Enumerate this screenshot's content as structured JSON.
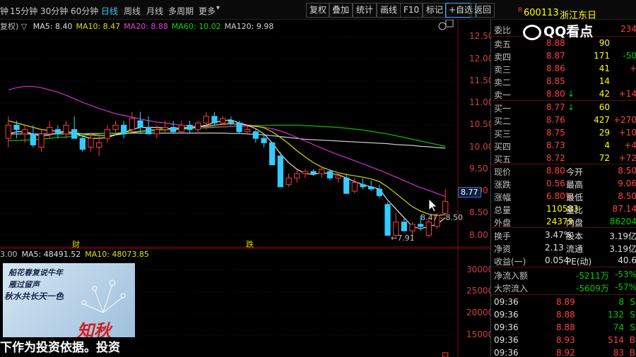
{
  "toolbar": {
    "periods": [
      "钟",
      "15分钟",
      "30分钟",
      "60分钟",
      "日线",
      "周线",
      "月线",
      "多周期",
      "更多"
    ],
    "active_period": "日线",
    "buttons": [
      "复权",
      "叠加",
      "统计",
      "画线",
      "F10",
      "标记",
      "+自选",
      "返回"
    ]
  },
  "stock": {
    "code": "600113",
    "name": "浙江东日",
    "code_prefix": "R"
  },
  "ma_legend": {
    "prefix": "复权) ▽",
    "items": [
      {
        "label": "MA5: 8.40",
        "color": "#e0e0e0"
      },
      {
        "label": "MA10: 8.47",
        "color": "#e0e000"
      },
      {
        "label": "MA20: 8.88",
        "color": "#e040e0"
      },
      {
        "label": "MA60: 10.02",
        "color": "#00dd00"
      },
      {
        "label": "MA120: 9.98",
        "color": "#d0d0d0"
      }
    ]
  },
  "vol_legend": {
    "items": [
      {
        "label": "3.00",
        "color": "#c0c0c0"
      },
      {
        "label": "MA5: 48491.52",
        "color": "#e0e0e0"
      },
      {
        "label": "MA10: 48073.85",
        "color": "#e0e000"
      }
    ]
  },
  "price_axis": [
    "12.50",
    "12.00",
    "11.50",
    "11.00",
    "10.50",
    "10.00",
    "9.50",
    "9.00",
    "8.50",
    "8.00"
  ],
  "vol_axis": [
    "30000",
    "25000",
    "20000",
    "15000"
  ],
  "annotations": {
    "current_price": "8.77",
    "ma_flag": "8.47 - 8.50",
    "low_flag": "←7.91",
    "event_1": "财",
    "event_2": "跌"
  },
  "chart_data": {
    "type": "candlestick",
    "ylim": [
      7.8,
      12.7
    ],
    "candles": [
      {
        "o": 10.2,
        "h": 10.7,
        "l": 10.0,
        "c": 10.5
      },
      {
        "o": 10.5,
        "h": 10.6,
        "l": 10.2,
        "c": 10.4
      },
      {
        "o": 10.3,
        "h": 10.5,
        "l": 10.1,
        "c": 10.4
      },
      {
        "o": 10.3,
        "h": 10.5,
        "l": 10.0,
        "c": 10.05
      },
      {
        "o": 10.0,
        "h": 10.4,
        "l": 9.9,
        "c": 10.3
      },
      {
        "o": 10.3,
        "h": 10.6,
        "l": 10.2,
        "c": 10.45
      },
      {
        "o": 10.4,
        "h": 10.5,
        "l": 10.2,
        "c": 10.3
      },
      {
        "o": 10.3,
        "h": 10.6,
        "l": 10.2,
        "c": 10.5
      },
      {
        "o": 10.4,
        "h": 10.7,
        "l": 10.2,
        "c": 10.2
      },
      {
        "o": 10.2,
        "h": 10.3,
        "l": 9.9,
        "c": 9.95
      },
      {
        "o": 10.0,
        "h": 10.3,
        "l": 9.9,
        "c": 10.2
      },
      {
        "o": 10.0,
        "h": 10.3,
        "l": 9.8,
        "c": 10.1
      },
      {
        "o": 10.2,
        "h": 10.5,
        "l": 10.1,
        "c": 10.4
      },
      {
        "o": 10.4,
        "h": 10.6,
        "l": 10.3,
        "c": 10.5
      },
      {
        "o": 10.5,
        "h": 10.6,
        "l": 10.2,
        "c": 10.3
      },
      {
        "o": 10.4,
        "h": 10.8,
        "l": 10.3,
        "c": 10.65
      },
      {
        "o": 10.6,
        "h": 10.8,
        "l": 10.3,
        "c": 10.45
      },
      {
        "o": 10.45,
        "h": 10.7,
        "l": 10.3,
        "c": 10.3
      },
      {
        "o": 10.3,
        "h": 10.5,
        "l": 10.2,
        "c": 10.4
      },
      {
        "o": 10.4,
        "h": 10.6,
        "l": 10.3,
        "c": 10.45
      },
      {
        "o": 10.45,
        "h": 10.6,
        "l": 10.3,
        "c": 10.35
      },
      {
        "o": 10.35,
        "h": 10.6,
        "l": 10.3,
        "c": 10.5
      },
      {
        "o": 10.5,
        "h": 10.6,
        "l": 10.3,
        "c": 10.4
      },
      {
        "o": 10.4,
        "h": 10.6,
        "l": 10.3,
        "c": 10.55
      },
      {
        "o": 10.55,
        "h": 10.8,
        "l": 10.4,
        "c": 10.7
      },
      {
        "o": 10.7,
        "h": 10.8,
        "l": 10.5,
        "c": 10.55
      },
      {
        "o": 10.55,
        "h": 10.7,
        "l": 10.5,
        "c": 10.65
      },
      {
        "o": 10.6,
        "h": 10.7,
        "l": 10.5,
        "c": 10.55
      },
      {
        "o": 10.55,
        "h": 10.6,
        "l": 10.3,
        "c": 10.35
      },
      {
        "o": 10.35,
        "h": 10.5,
        "l": 10.3,
        "c": 10.4
      },
      {
        "o": 10.35,
        "h": 10.4,
        "l": 10.1,
        "c": 10.2
      },
      {
        "o": 10.2,
        "h": 10.3,
        "l": 10.0,
        "c": 10.1
      },
      {
        "o": 10.1,
        "h": 10.1,
        "l": 9.6,
        "c": 9.6
      },
      {
        "o": 9.8,
        "h": 9.9,
        "l": 9.1,
        "c": 9.1
      },
      {
        "o": 9.15,
        "h": 9.4,
        "l": 9.1,
        "c": 9.3
      },
      {
        "o": 9.3,
        "h": 9.5,
        "l": 9.2,
        "c": 9.4
      },
      {
        "o": 9.4,
        "h": 9.5,
        "l": 9.3,
        "c": 9.45
      },
      {
        "o": 9.45,
        "h": 9.5,
        "l": 9.35,
        "c": 9.4
      },
      {
        "o": 9.4,
        "h": 9.55,
        "l": 9.3,
        "c": 9.5
      },
      {
        "o": 9.45,
        "h": 9.5,
        "l": 9.25,
        "c": 9.3
      },
      {
        "o": 9.3,
        "h": 9.4,
        "l": 9.2,
        "c": 9.35
      },
      {
        "o": 9.3,
        "h": 9.4,
        "l": 8.95,
        "c": 8.95
      },
      {
        "o": 9.0,
        "h": 9.3,
        "l": 8.95,
        "c": 9.2
      },
      {
        "o": 9.15,
        "h": 9.3,
        "l": 9.05,
        "c": 9.1
      },
      {
        "o": 9.1,
        "h": 9.25,
        "l": 9.0,
        "c": 9.05
      },
      {
        "o": 9.05,
        "h": 9.15,
        "l": 8.85,
        "c": 8.9
      },
      {
        "o": 8.7,
        "h": 8.75,
        "l": 8.0,
        "c": 8.0
      },
      {
        "o": 8.0,
        "h": 8.5,
        "l": 7.95,
        "c": 8.3
      },
      {
        "o": 8.3,
        "h": 8.4,
        "l": 8.1,
        "c": 8.1
      },
      {
        "o": 8.1,
        "h": 8.3,
        "l": 7.91,
        "c": 8.25
      },
      {
        "o": 8.25,
        "h": 8.45,
        "l": 8.1,
        "c": 8.2
      },
      {
        "o": 8.0,
        "h": 8.4,
        "l": 7.95,
        "c": 8.3
      },
      {
        "o": 8.2,
        "h": 8.5,
        "l": 8.15,
        "c": 8.45
      },
      {
        "o": 8.5,
        "h": 9.05,
        "l": 8.45,
        "c": 8.77
      }
    ],
    "ma5": [
      10.3,
      10.35,
      10.35,
      10.3,
      10.25,
      10.28,
      10.32,
      10.35,
      10.32,
      10.25,
      10.2,
      10.2,
      10.22,
      10.28,
      10.33,
      10.4,
      10.45,
      10.45,
      10.45,
      10.44,
      10.4,
      10.42,
      10.44,
      10.46,
      10.5,
      10.56,
      10.6,
      10.62,
      10.55,
      10.5,
      10.42,
      10.3,
      10.1,
      9.85,
      9.65,
      9.5,
      9.4,
      9.38,
      9.42,
      9.4,
      9.38,
      9.3,
      9.22,
      9.15,
      9.1,
      9.05,
      8.8,
      8.6,
      8.4,
      8.2,
      8.15,
      8.2,
      8.25,
      8.4
    ],
    "ma10": [
      10.6,
      10.55,
      10.5,
      10.45,
      10.4,
      10.38,
      10.36,
      10.35,
      10.33,
      10.3,
      10.28,
      10.26,
      10.26,
      10.28,
      10.3,
      10.33,
      10.36,
      10.38,
      10.4,
      10.42,
      10.43,
      10.44,
      10.45,
      10.46,
      10.48,
      10.5,
      10.52,
      10.53,
      10.52,
      10.5,
      10.48,
      10.44,
      10.35,
      10.22,
      10.08,
      9.92,
      9.78,
      9.65,
      9.55,
      9.48,
      9.42,
      9.38,
      9.35,
      9.32,
      9.28,
      9.22,
      9.1,
      8.95,
      8.8,
      8.65,
      8.55,
      8.48,
      8.45,
      8.47
    ],
    "ma20": [
      11.3,
      11.35,
      11.38,
      11.38,
      11.35,
      11.3,
      11.25,
      11.18,
      11.1,
      11.02,
      10.95,
      10.88,
      10.82,
      10.76,
      10.72,
      10.68,
      10.64,
      10.6,
      10.57,
      10.55,
      10.52,
      10.5,
      10.48,
      10.47,
      10.46,
      10.46,
      10.46,
      10.47,
      10.48,
      10.48,
      10.47,
      10.45,
      10.42,
      10.37,
      10.3,
      10.22,
      10.14,
      10.06,
      9.98,
      9.9,
      9.83,
      9.76,
      9.69,
      9.62,
      9.55,
      9.48,
      9.4,
      9.32,
      9.24,
      9.16,
      9.08,
      9.02,
      8.95,
      8.88
    ],
    "ma60": [
      10.15,
      10.15,
      10.16,
      10.17,
      10.18,
      10.2,
      10.22,
      10.23,
      10.25,
      10.26,
      10.28,
      10.3,
      10.31,
      10.32,
      10.34,
      10.35,
      10.36,
      10.37,
      10.38,
      10.39,
      10.4,
      10.41,
      10.42,
      10.43,
      10.44,
      10.45,
      10.46,
      10.47,
      10.48,
      10.48,
      10.49,
      10.49,
      10.5,
      10.5,
      10.5,
      10.5,
      10.49,
      10.48,
      10.47,
      10.46,
      10.45,
      10.43,
      10.41,
      10.39,
      10.36,
      10.33,
      10.3,
      10.26,
      10.22,
      10.18,
      10.14,
      10.1,
      10.06,
      10.02
    ],
    "ma120": [
      10.3,
      10.3,
      10.3,
      10.3,
      10.3,
      10.3,
      10.3,
      10.3,
      10.3,
      10.3,
      10.31,
      10.31,
      10.31,
      10.31,
      10.31,
      10.32,
      10.32,
      10.32,
      10.32,
      10.32,
      10.32,
      10.32,
      10.32,
      10.32,
      10.32,
      10.32,
      10.32,
      10.31,
      10.31,
      10.3,
      10.29,
      10.28,
      10.26,
      10.24,
      10.22,
      10.2,
      10.18,
      10.17,
      10.16,
      10.15,
      10.14,
      10.13,
      10.12,
      10.11,
      10.1,
      10.09,
      10.08,
      10.06,
      10.05,
      10.04,
      10.02,
      10.01,
      9.99,
      9.98
    ],
    "volume_ylim": [
      10000,
      33000
    ],
    "volume_last": 11000
  },
  "order_book": {
    "header": {
      "label": "委比",
      "val1": "",
      "val2": "234"
    },
    "asks": [
      {
        "label": "卖五",
        "price": "8.88",
        "vol": "90",
        "chg": ""
      },
      {
        "label": "卖四",
        "price": "8.87",
        "vol": "171",
        "chg": "-50"
      },
      {
        "label": "卖三",
        "price": "8.86",
        "vol": "41",
        "chg": "+"
      },
      {
        "label": "卖二",
        "price": "8.85",
        "vol": "14",
        "chg": ""
      },
      {
        "label": "卖一",
        "price": "8.80",
        "arrow": "↓",
        "vol": "42",
        "chg": "+14"
      }
    ],
    "bids": [
      {
        "label": "买一",
        "price": "8.77",
        "arrow": "↓",
        "vol": "60",
        "chg": ""
      },
      {
        "label": "买二",
        "price": "8.76",
        "vol": "427",
        "chg": "+270"
      },
      {
        "label": "买三",
        "price": "8.75",
        "vol": "29",
        "chg": "+10"
      },
      {
        "label": "买四",
        "price": "8.73",
        "vol": "4",
        "chg": "+4"
      },
      {
        "label": "买五",
        "price": "8.72",
        "vol": "72",
        "chg": "+72"
      }
    ]
  },
  "quote": [
    {
      "l1": "现价",
      "v1": "8.80",
      "l2": "今开",
      "v2": "8.50"
    },
    {
      "l1": "涨跌",
      "v1": "0.56",
      "l2": "最高",
      "v2": "9.06"
    },
    {
      "l1": "涨幅",
      "v1": "6.80%",
      "l2": "最低",
      "v2": "8.50"
    },
    {
      "l1": "总量",
      "v1": "110583",
      "l2": "量比",
      "v2": "87.14"
    },
    {
      "l1": "外盘",
      "v1": "24379",
      "l2": "内盘",
      "v2": "86204"
    }
  ],
  "fundamentals": [
    {
      "l1": "换手",
      "v1": "3.47%",
      "l2": "股本",
      "v2": "3.19亿"
    },
    {
      "l1": "净资",
      "v1": "2.13",
      "l2": "流通",
      "v2": "3.19亿"
    },
    {
      "l1": "收益(一)",
      "v1": "0.054",
      "l2": "PE(动)",
      "v2": "40.6"
    }
  ],
  "flows": [
    {
      "label": "净流入额",
      "amount": "-5211万",
      "pct": "-53%"
    },
    {
      "label": "大宗流入",
      "amount": "-5609万",
      "pct": "-57%"
    }
  ],
  "ticks": [
    {
      "time": "09:36",
      "price": "8.89",
      "vol": "8",
      "flag": "S"
    },
    {
      "time": "09:36",
      "price": "8.88",
      "vol": "132",
      "flag": "S"
    },
    {
      "time": "09:36",
      "price": "8.88",
      "vol": "74",
      "flag": "S"
    },
    {
      "time": "09:36",
      "price": "8.93",
      "vol": "514",
      "flag": "B"
    },
    {
      "time": "09:36",
      "price": "8.92",
      "vol": "83",
      "flag": "B"
    }
  ],
  "overlay": {
    "qq_logo": "QQ看点",
    "promo_lines": [
      "船花春复说牛年",
      "雁过留声",
      "秋水共长天一色",
      "知秋"
    ],
    "subtitle": "下作为投资依据。投资"
  }
}
